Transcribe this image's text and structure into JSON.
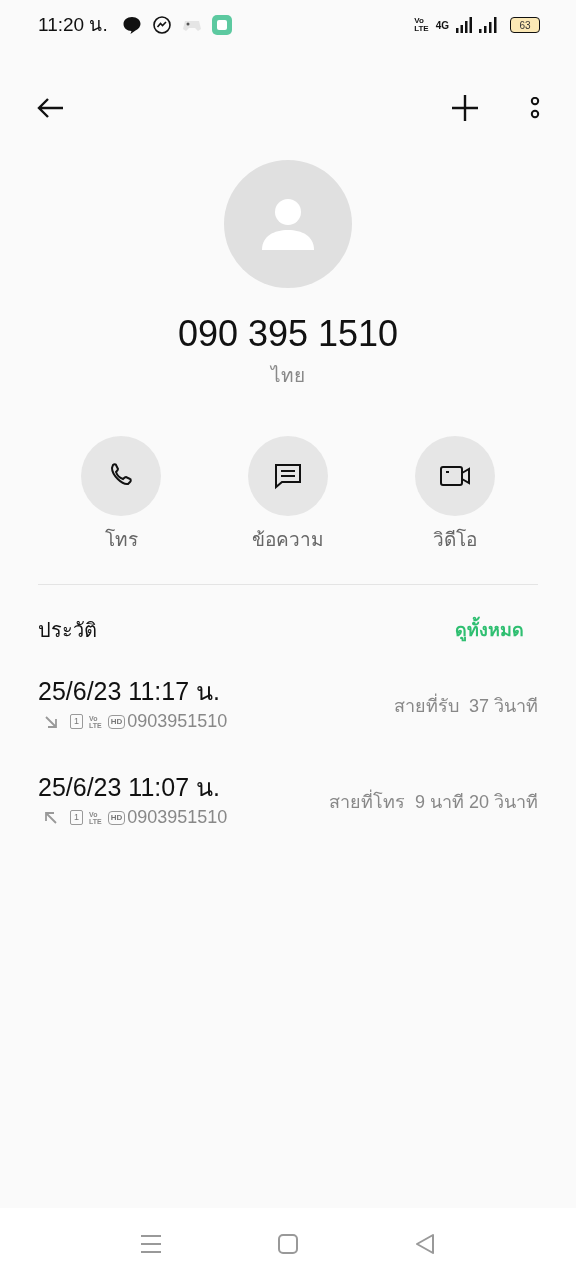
{
  "status_bar": {
    "time": "11:20 น.",
    "volte": [
      "Vo",
      "LTE"
    ],
    "network": "4G",
    "battery": "63"
  },
  "contact": {
    "number": "090 395 1510",
    "location": "ไทย"
  },
  "actions": [
    {
      "kind": "call",
      "label": "โทร"
    },
    {
      "kind": "message",
      "label": "ข้อความ"
    },
    {
      "kind": "video",
      "label": "วิดีโอ"
    }
  ],
  "history": {
    "title": "ประวัติ",
    "see_all": "ดูทั้งหมด",
    "calls": [
      {
        "kind": "incoming",
        "datetime": "25/6/23 11:17 น.",
        "sim": "1",
        "volte": [
          "Vo",
          "LTE"
        ],
        "hd": "HD",
        "number": "0903951510",
        "type": "สายที่รับ",
        "duration": "37 วินาที"
      },
      {
        "kind": "outgoing",
        "datetime": "25/6/23 11:07 น.",
        "sim": "1",
        "volte": [
          "Vo",
          "LTE"
        ],
        "hd": "HD",
        "number": "0903951510",
        "type": "สายที่โทร",
        "duration": "9 นาที 20 วินาที"
      }
    ]
  }
}
